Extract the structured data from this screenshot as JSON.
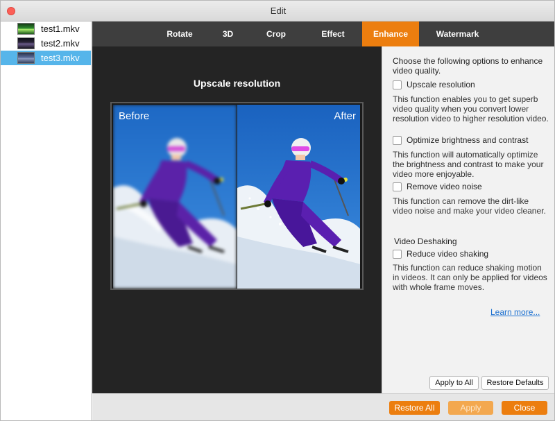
{
  "window": {
    "title": "Edit"
  },
  "files": [
    {
      "name": "test1.mkv",
      "selected": false
    },
    {
      "name": "test2.mkv",
      "selected": false
    },
    {
      "name": "test3.mkv",
      "selected": true
    }
  ],
  "tabs": [
    {
      "label": "Rotate",
      "active": false
    },
    {
      "label": "3D",
      "active": false
    },
    {
      "label": "Crop",
      "active": false
    },
    {
      "label": "Effect",
      "active": false
    },
    {
      "label": "Enhance",
      "active": true
    },
    {
      "label": "Watermark",
      "active": false
    }
  ],
  "preview": {
    "title": "Upscale resolution",
    "before_label": "Before",
    "after_label": "After"
  },
  "enhance": {
    "intro": "Choose the following options to enhance video quality.",
    "options": [
      {
        "label": "Upscale resolution",
        "checked": false,
        "description": "This function enables you to get superb video quality when you convert lower resolution video to higher resolution video."
      },
      {
        "label": "Optimize brightness and contrast",
        "checked": false,
        "description": "This function will automatically optimize the brightness and contrast to make your video more enjoyable."
      },
      {
        "label": "Remove video noise",
        "checked": false,
        "description": "This function can remove the dirt-like video noise and make your video cleaner."
      }
    ],
    "deshake": {
      "section_title": "Video Deshaking",
      "label": "Reduce video shaking",
      "checked": false,
      "description": "This function can reduce shaking motion in videos. It can only be applied for videos with whole frame moves."
    },
    "learn_more": "Learn more...",
    "apply_to_all": "Apply to All",
    "restore_defaults": "Restore Defaults"
  },
  "footer": {
    "restore_all": "Restore All",
    "apply": "Apply",
    "close": "Close"
  },
  "colors": {
    "accent": "#ec7e0f",
    "selection": "#56b5ea",
    "tabbar": "#3e3e3e",
    "preview_bg": "#242424",
    "link": "#1a6fd0"
  }
}
